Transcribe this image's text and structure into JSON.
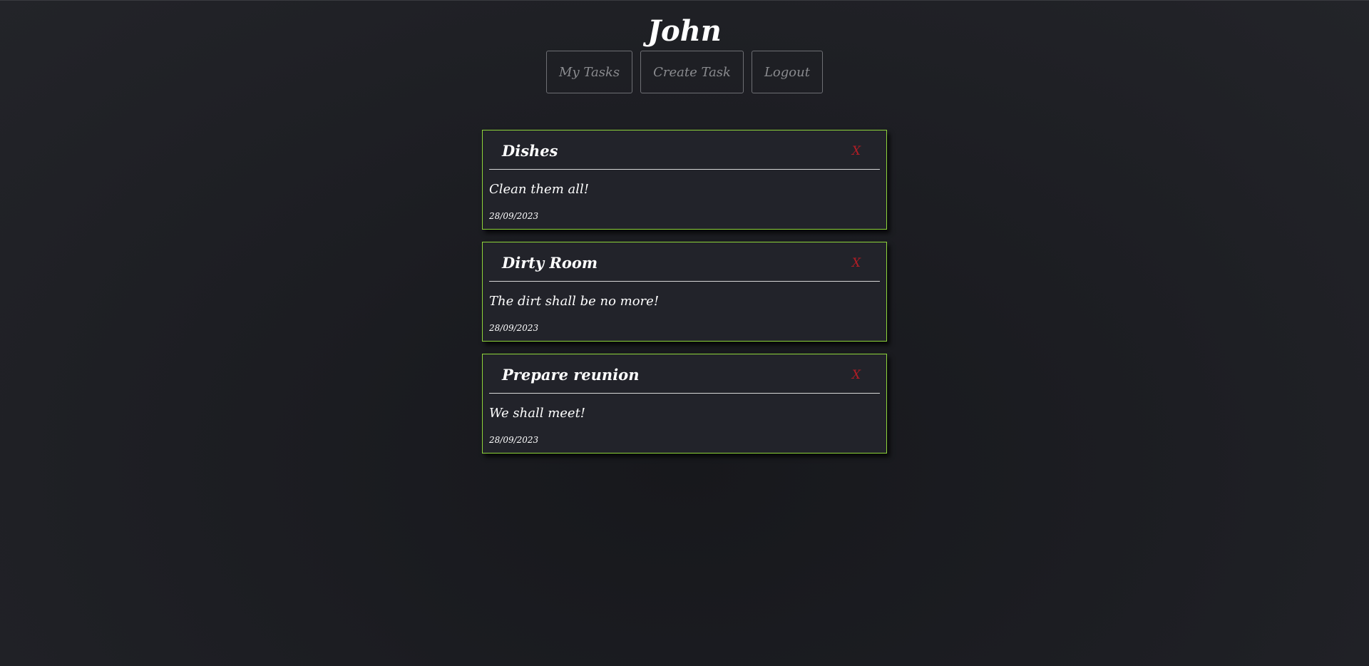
{
  "header": {
    "username": "John"
  },
  "nav": {
    "my_tasks": "My Tasks",
    "create_task": "Create Task",
    "logout": "Logout"
  },
  "tasks": [
    {
      "title": "Dishes",
      "delete_label": "X",
      "description": "Clean them all!",
      "date": "28/09/2023"
    },
    {
      "title": "Dirty Room",
      "delete_label": "X",
      "description": "The dirt shall be no more!",
      "date": "28/09/2023"
    },
    {
      "title": "Prepare reunion",
      "delete_label": "X",
      "description": "We shall meet!",
      "date": "28/09/2023"
    }
  ],
  "colors": {
    "card_border": "#8ed43a",
    "delete": "#b01d25",
    "background": "#1c1d22"
  }
}
